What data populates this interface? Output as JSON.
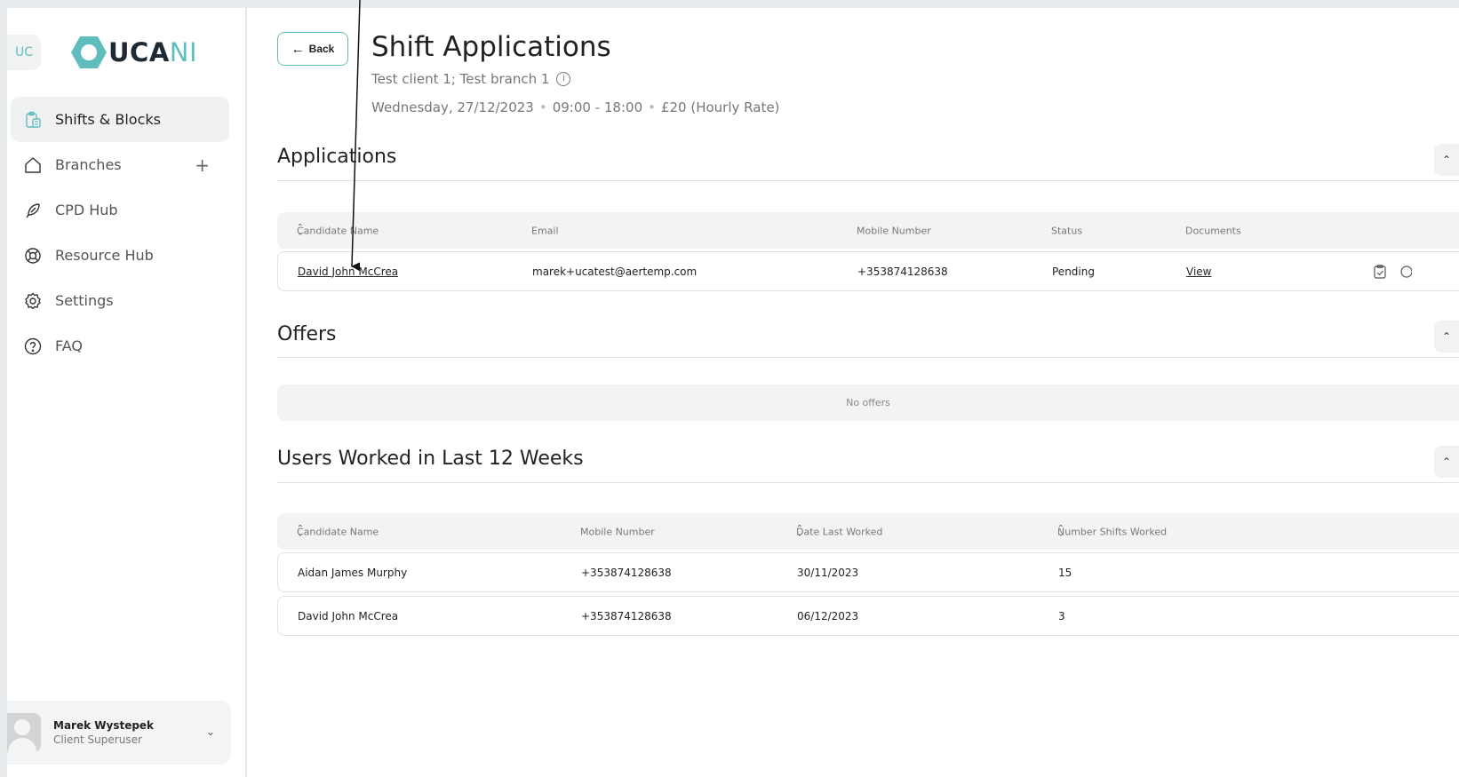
{
  "sidebar": {
    "badge": "UC",
    "logo_main": "UCA",
    "logo_accent": "NI",
    "items": [
      {
        "label": "Shifts & Blocks",
        "icon": "clipboard-icon"
      },
      {
        "label": "Branches",
        "icon": "home-icon",
        "add": "+"
      },
      {
        "label": "CPD Hub",
        "icon": "feather-icon"
      },
      {
        "label": "Resource Hub",
        "icon": "lifebuoy-icon"
      },
      {
        "label": "Settings",
        "icon": "gear-icon"
      },
      {
        "label": "FAQ",
        "icon": "help-circle-icon"
      }
    ],
    "user": {
      "name": "Marek Wystepek",
      "role": "Client Superuser"
    }
  },
  "header": {
    "back_label": "Back",
    "title": "Shift Applications",
    "subtitle": "Test client 1; Test branch 1",
    "date": "Wednesday, 27/12/2023",
    "time": "09:00 - 18:00",
    "rate": "£20 (Hourly Rate)"
  },
  "applications": {
    "title": "Applications",
    "columns": [
      "Candidate Name",
      "Email",
      "Mobile Number",
      "Status",
      "Documents"
    ],
    "rows": [
      {
        "name": "David John McCrea",
        "email": "marek+ucatest@aertemp.com",
        "mobile": "+353874128638",
        "status": "Pending",
        "documents": "View"
      }
    ]
  },
  "offers": {
    "title": "Offers",
    "empty": "No offers"
  },
  "worked": {
    "title": "Users Worked in Last 12 Weeks",
    "columns": [
      "Candidate Name",
      "Mobile Number",
      "Date Last Worked",
      "Number Shifts Worked"
    ],
    "rows": [
      {
        "name": "Aidan James Murphy",
        "mobile": "+353874128638",
        "date": "30/11/2023",
        "shifts": "15"
      },
      {
        "name": "David John McCrea",
        "mobile": "+353874128638",
        "date": "06/12/2023",
        "shifts": "3"
      }
    ]
  },
  "colors": {
    "accent": "#5fbdbd",
    "dark": "#1d2a33"
  }
}
